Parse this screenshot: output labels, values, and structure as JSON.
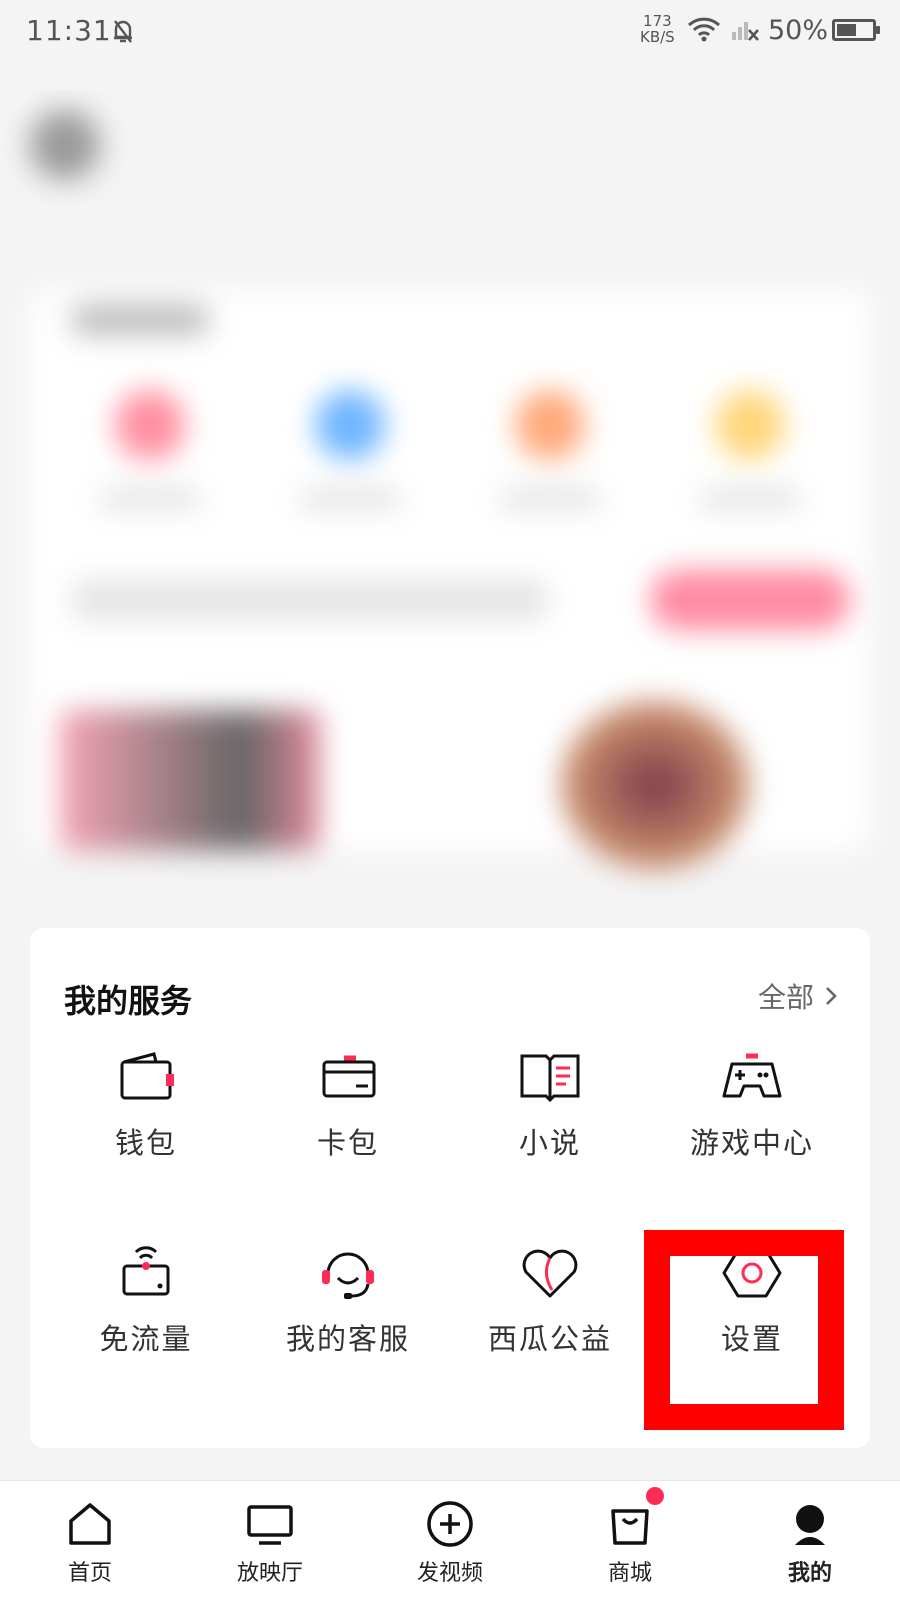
{
  "status_bar": {
    "time": "11:31",
    "speed_value": "173",
    "speed_unit": "KB/S",
    "battery": "50%"
  },
  "services": {
    "title": "我的服务",
    "all_label": "全部",
    "items": [
      {
        "label": "钱包",
        "icon": "wallet-icon"
      },
      {
        "label": "卡包",
        "icon": "card-wallet-icon"
      },
      {
        "label": "小说",
        "icon": "book-icon"
      },
      {
        "label": "游戏中心",
        "icon": "gamepad-icon"
      },
      {
        "label": "免流量",
        "icon": "free-data-icon"
      },
      {
        "label": "我的客服",
        "icon": "headset-icon"
      },
      {
        "label": "西瓜公益",
        "icon": "heart-icon"
      },
      {
        "label": "设置",
        "icon": "settings-hexagon-icon"
      }
    ]
  },
  "bottom_nav": {
    "items": [
      {
        "label": "首页",
        "icon": "home-icon"
      },
      {
        "label": "放映厅",
        "icon": "tv-icon"
      },
      {
        "label": "发视频",
        "icon": "plus-circle-icon"
      },
      {
        "label": "商城",
        "icon": "shopping-bag-icon"
      },
      {
        "label": "我的",
        "icon": "profile-icon",
        "active": true
      }
    ]
  },
  "colors": {
    "accent": "#fe2c55",
    "highlight": "#ff0000",
    "text": "#222222"
  }
}
